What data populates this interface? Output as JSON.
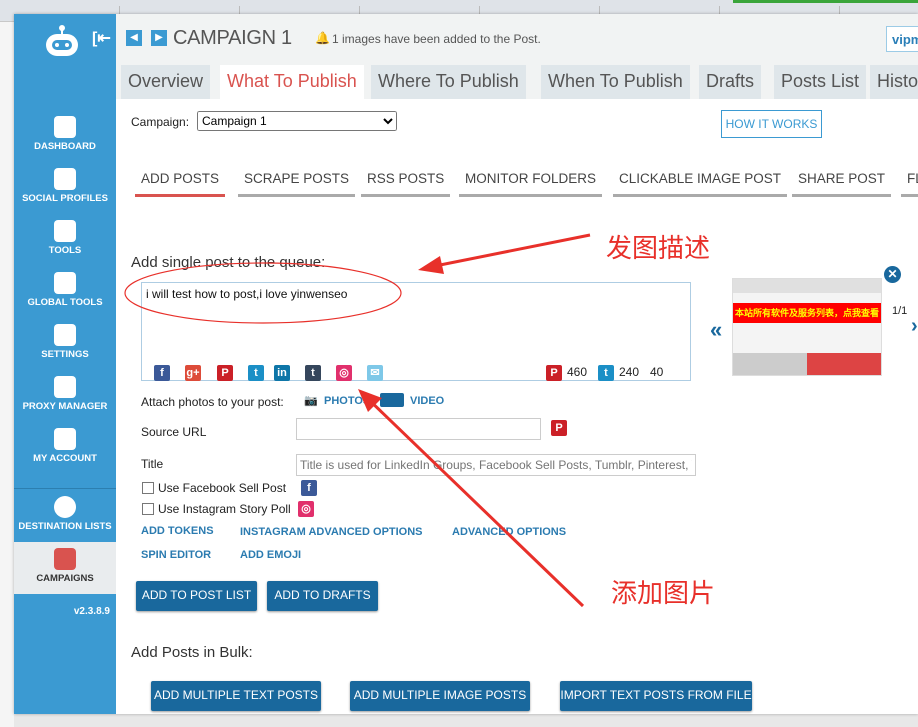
{
  "header": {
    "title": "CAMPAIGN 1",
    "notice": "1 images have been added to the Post.",
    "user": "vipm"
  },
  "sidebar": {
    "items": [
      {
        "label": "DASHBOARD",
        "icon": "dashboard-icon"
      },
      {
        "label": "SOCIAL PROFILES",
        "icon": "social-profiles-icon"
      },
      {
        "label": "TOOLS",
        "icon": "tools-icon"
      },
      {
        "label": "GLOBAL TOOLS",
        "icon": "global-tools-icon"
      },
      {
        "label": "SETTINGS",
        "icon": "settings-icon"
      },
      {
        "label": "PROXY MANAGER",
        "icon": "proxy-icon"
      },
      {
        "label": "MY ACCOUNT",
        "icon": "user-icon"
      },
      {
        "label": "DESTINATION LISTS",
        "icon": "map-pin-icon"
      },
      {
        "label": "CAMPAIGNS",
        "icon": "calendar-icon"
      }
    ],
    "version": "v2.3.8.9"
  },
  "tabs": [
    "Overview",
    "What To Publish",
    "Where To Publish",
    "When To Publish",
    "Drafts",
    "Posts List",
    "Histo"
  ],
  "campaign": {
    "label": "Campaign:",
    "selected": "Campaign 1",
    "how_it_works": "HOW IT WORKS"
  },
  "subtabs": [
    "ADD POSTS",
    "SCRAPE POSTS",
    "RSS POSTS",
    "MONITOR FOLDERS",
    "CLICKABLE IMAGE POST",
    "SHARE POST",
    "FL"
  ],
  "post": {
    "heading": "Add single post to the queue:",
    "text": "i will test how to post,i love yinwenseo",
    "counts": {
      "pinterest": "460",
      "twitter": "240",
      "other": "40"
    },
    "preview_counter": "1/1",
    "preview_banner": "本站所有软件及服务列表，点我查看"
  },
  "attach": {
    "label": "Attach photos to your post:",
    "photos": "PHOTOS",
    "video": "VIDEO"
  },
  "source_url": {
    "label": "Source URL",
    "value": ""
  },
  "title_field": {
    "label": "Title",
    "placeholder": "Title is used for LinkedIn Groups, Facebook Sell Posts, Tumblr, Pinterest, Yo"
  },
  "checks": [
    {
      "label": "Use Facebook Sell Post",
      "checked": false
    },
    {
      "label": "Use Instagram Story Poll",
      "checked": false
    }
  ],
  "links": [
    "ADD TOKENS",
    "INSTAGRAM ADVANCED OPTIONS",
    "ADVANCED OPTIONS",
    "SPIN EDITOR",
    "ADD EMOJI"
  ],
  "buttons": {
    "add_to_post_list": "ADD TO POST LIST",
    "add_to_drafts": "ADD TO DRAFTS"
  },
  "bulk": {
    "heading": "Add Posts in Bulk:",
    "buttons": [
      "ADD MULTIPLE TEXT POSTS",
      "ADD MULTIPLE IMAGE POSTS",
      "IMPORT TEXT POSTS FROM FILE"
    ]
  },
  "annotations": {
    "describe": "发图描述",
    "add_image": "添加图片"
  },
  "colors": {
    "sidebar": "#3b9ad2",
    "accent": "#d9534f",
    "button": "#19689d",
    "annotation": "#e8302a"
  }
}
